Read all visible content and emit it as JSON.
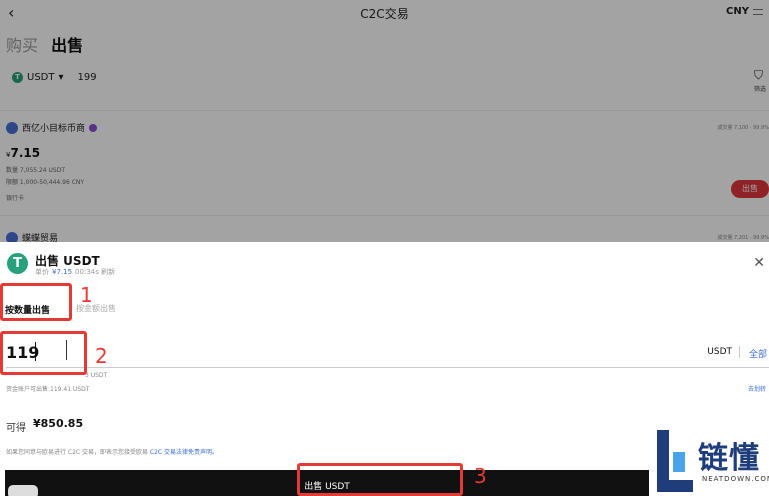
{
  "header": {
    "title": "C2C交易",
    "currency": "CNY"
  },
  "tabs": {
    "buy": "购买",
    "sell": "出售"
  },
  "filter": {
    "coin": "USDT",
    "amount": "199",
    "filter_label": "筛选"
  },
  "merchants": [
    {
      "name": "西亿小目标币商",
      "stats": "成交量 7,100 · 99.9%",
      "price": "7.15",
      "currency_symbol": "¥",
      "quantity": "数量 7,055.24 USDT",
      "limit": "限额 1,000-50,444.96 CNY",
      "payment": "银行卡",
      "sell_label": "出售"
    },
    {
      "name": "蝶蝶贸易",
      "stats": "成交量 7,201 · 99.9%"
    }
  ],
  "sheet": {
    "title": "出售 USDT",
    "unit_price_label": "单价",
    "unit_price": "¥7.15",
    "countdown": "00:34s 刷新",
    "close_icon": "close-icon",
    "mode_tab_qty": "按数量出售",
    "mode_tab_amount": "按金额出售",
    "quantity_value": "119",
    "unit": "USDT",
    "all_label": "全部",
    "hint_limit": "3 USDT",
    "hint_available": "资金账户可出售:119.41 USDT",
    "transfer_label": "去划转",
    "receive_label": "可得",
    "receive_value": "¥850.85",
    "disclaimer_prefix": "如果您同意与欧易进行 C2C 交易，即表示您接受欧易 ",
    "disclaimer_link": "C2C 交易法律免责声明。",
    "submit_label": "出售 USDT"
  },
  "annotations": [
    "1",
    "2",
    "3"
  ],
  "watermark": {
    "text": "链懂",
    "url": "NEATDOWN.COM"
  },
  "colors": {
    "accent_blue": "#3a6fd8",
    "sell_red": "#e0363c",
    "usdt_green": "#26a17b",
    "annotation_red": "#e53935"
  }
}
